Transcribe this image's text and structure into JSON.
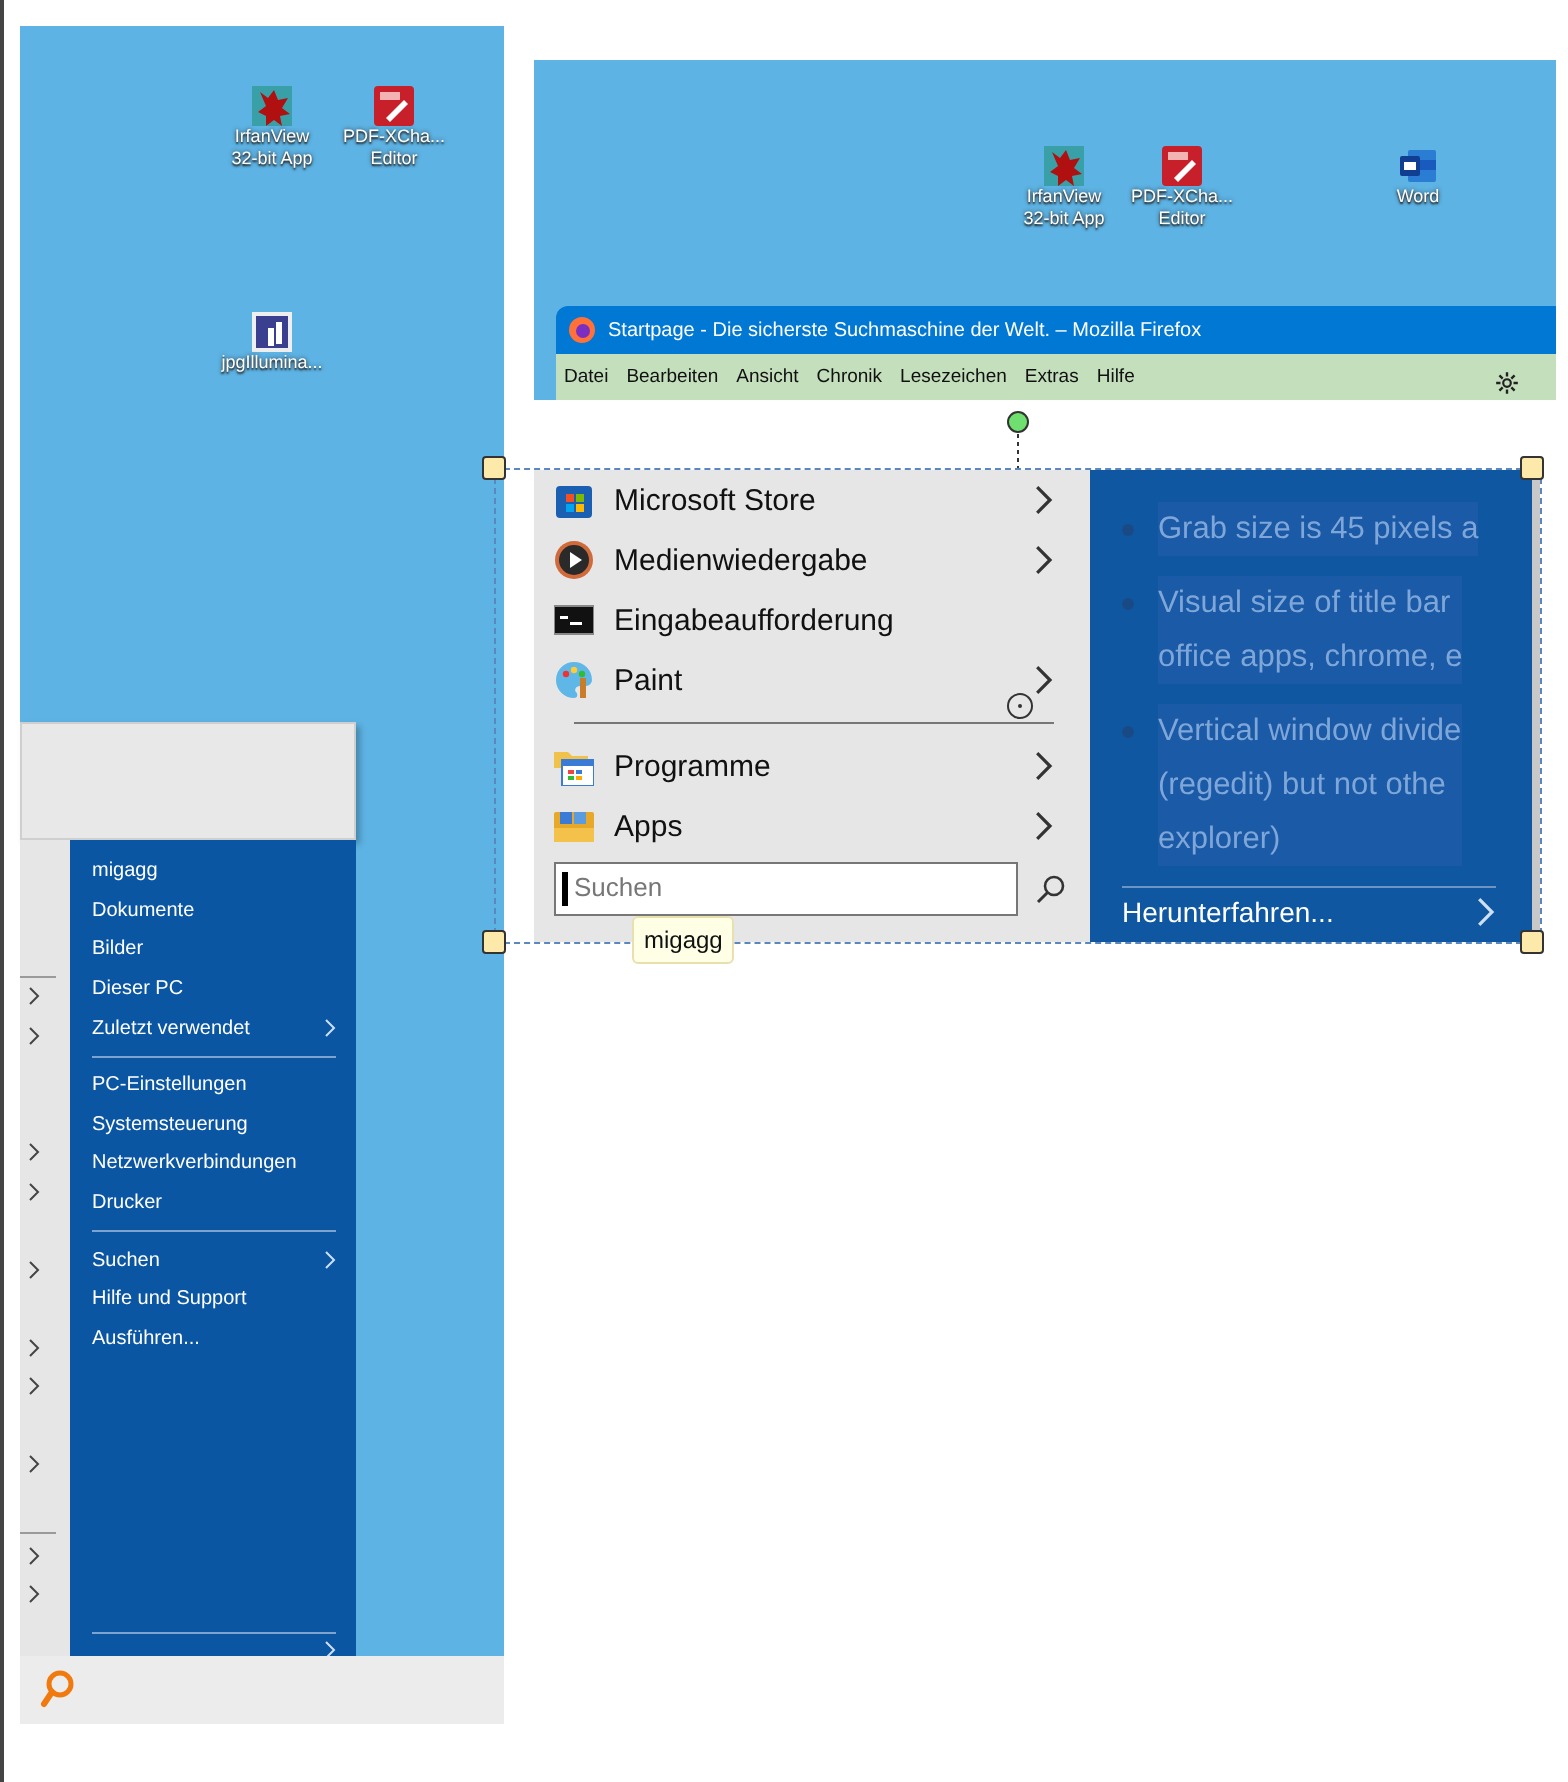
{
  "left_screenshot": {
    "desktop_icons": [
      {
        "kind": "irfanview",
        "lines": [
          "IrfanView",
          "32-bit App"
        ]
      },
      {
        "kind": "pdf",
        "lines": [
          "PDF-XCha...",
          "Editor"
        ]
      },
      {
        "kind": "jpg",
        "lines": [
          "jpgIllumina..."
        ]
      }
    ],
    "start_menu": {
      "items": [
        {
          "kind": "item",
          "label": "migagg",
          "submenu": false
        },
        {
          "kind": "item",
          "label": "Dokumente",
          "submenu": false
        },
        {
          "kind": "item",
          "label": "Bilder",
          "submenu": false
        },
        {
          "kind": "item",
          "label": "Dieser PC",
          "submenu": false
        },
        {
          "kind": "item",
          "label": "Zuletzt verwendet",
          "submenu": true
        },
        {
          "kind": "separator"
        },
        {
          "kind": "item",
          "label": "PC-Einstellungen",
          "submenu": false
        },
        {
          "kind": "item",
          "label": "Systemsteuerung",
          "submenu": false
        },
        {
          "kind": "item",
          "label": "Netzwerkverbindungen",
          "submenu": false
        },
        {
          "kind": "item",
          "label": "Drucker",
          "submenu": false
        },
        {
          "kind": "separator"
        },
        {
          "kind": "item",
          "label": "Suchen",
          "submenu": true
        },
        {
          "kind": "item",
          "label": "Hilfe und Support",
          "submenu": false
        },
        {
          "kind": "item",
          "label": "Ausführen...",
          "submenu": false
        }
      ]
    }
  },
  "right_screenshot": {
    "desktop_icons": [
      {
        "kind": "irfanview",
        "lines": [
          "IrfanView",
          "32-bit App"
        ]
      },
      {
        "kind": "pdf",
        "lines": [
          "PDF-XCha...",
          "Editor"
        ]
      },
      {
        "kind": "word",
        "lines": [
          "Word"
        ]
      }
    ],
    "browser": {
      "title": "Startpage - Die sicherste Suchmaschine der Welt. – Mozilla Firefox",
      "menu": [
        "Datei",
        "Bearbeiten",
        "Ansicht",
        "Chronik",
        "Lesezeichen",
        "Extras",
        "Hilfe"
      ]
    }
  },
  "selected_screenshot": {
    "selected": true,
    "start_menu": {
      "items": [
        {
          "kind": "store",
          "label": "Microsoft Store",
          "submenu": true
        },
        {
          "kind": "media",
          "label": "Medienwiedergabe",
          "submenu": true
        },
        {
          "kind": "cmd",
          "label": "Eingabeaufforderung",
          "submenu": false
        },
        {
          "kind": "paint",
          "label": "Paint",
          "submenu": true
        },
        {
          "kind": "separator"
        },
        {
          "kind": "programs",
          "label": "Programme",
          "submenu": true
        },
        {
          "kind": "apps",
          "label": "Apps",
          "submenu": true
        }
      ],
      "search": {
        "placeholder": "Suchen"
      },
      "tooltip": "migagg"
    },
    "right_panel": {
      "faded_bullets": [
        [
          "Grab size is 45 pixels a"
        ],
        [
          "Visual size of title bar",
          "office apps, chrome, e"
        ],
        [
          "Vertical window divide",
          "(regedit) but not othe",
          "explorer)"
        ]
      ],
      "shutdown": "Herunterfahren..."
    }
  }
}
